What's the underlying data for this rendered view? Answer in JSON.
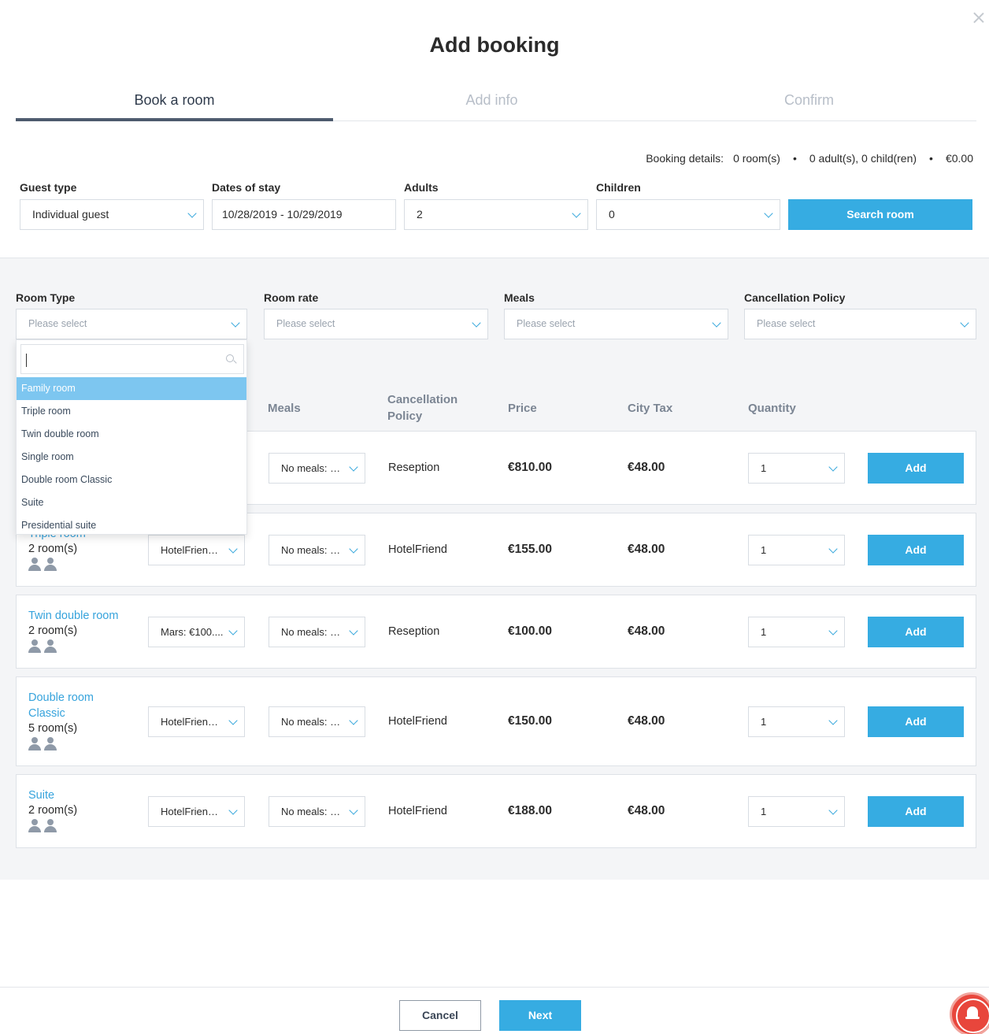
{
  "modal": {
    "title": "Add booking"
  },
  "tabs": [
    {
      "label": "Book a room"
    },
    {
      "label": "Add info"
    },
    {
      "label": "Confirm"
    }
  ],
  "booking_details": {
    "label": "Booking details:",
    "rooms": "0 room(s)",
    "guests": "0 adult(s), 0 child(ren)",
    "total": "€0.00",
    "separator": "•"
  },
  "search_form": {
    "guest_type": {
      "label": "Guest type",
      "value": "Individual guest"
    },
    "dates": {
      "label": "Dates of stay",
      "value": "10/28/2019 - 10/29/2019"
    },
    "adults": {
      "label": "Adults",
      "value": "2"
    },
    "children": {
      "label": "Children",
      "value": "0"
    },
    "search_button": "Search room"
  },
  "filters": {
    "room_type": {
      "label": "Room Type",
      "placeholder": "Please select"
    },
    "room_rate": {
      "label": "Room rate",
      "placeholder": "Please select"
    },
    "meals": {
      "label": "Meals",
      "placeholder": "Please select"
    },
    "cancellation": {
      "label": "Cancellation Policy",
      "placeholder": "Please select"
    }
  },
  "room_type_dropdown": {
    "search_value": "",
    "options": [
      {
        "label": "Family room",
        "selected": true
      },
      {
        "label": "Triple room",
        "selected": false
      },
      {
        "label": "Twin double room",
        "selected": false
      },
      {
        "label": "Single room",
        "selected": false
      },
      {
        "label": "Double room Classic",
        "selected": false
      },
      {
        "label": "Suite",
        "selected": false
      },
      {
        "label": "Presidential suite",
        "selected": false
      }
    ]
  },
  "table": {
    "headers": {
      "meals": "Meals",
      "cancellation": "Cancellation Policy",
      "price": "Price",
      "city_tax": "City Tax",
      "quantity": "Quantity"
    },
    "rows": [
      {
        "name": "",
        "rooms": "",
        "rate": "",
        "meals": "No meals: €...",
        "policy": "Reseption",
        "price": "€810.00",
        "city_tax": "€48.00",
        "quantity": "1",
        "add": "Add"
      },
      {
        "name": "Triple room",
        "rooms": "2 room(s)",
        "rate": "HotelFriend:...",
        "meals": "No meals: €...",
        "policy": "HotelFriend",
        "price": "€155.00",
        "city_tax": "€48.00",
        "quantity": "1",
        "add": "Add"
      },
      {
        "name": "Twin double room",
        "rooms": "2 room(s)",
        "rate": "Mars: €100....",
        "meals": "No meals: €...",
        "policy": "Reseption",
        "price": "€100.00",
        "city_tax": "€48.00",
        "quantity": "1",
        "add": "Add"
      },
      {
        "name": "Double room Classic",
        "rooms": "5 room(s)",
        "rate": "HotelFriend:...",
        "meals": "No meals: €...",
        "policy": "HotelFriend",
        "price": "€150.00",
        "city_tax": "€48.00",
        "quantity": "1",
        "add": "Add"
      },
      {
        "name": "Suite",
        "rooms": "2 room(s)",
        "rate": "HotelFriend:...",
        "meals": "No meals: €...",
        "policy": "HotelFriend",
        "price": "€188.00",
        "city_tax": "€48.00",
        "quantity": "1",
        "add": "Add"
      }
    ]
  },
  "footer": {
    "cancel": "Cancel",
    "next": "Next"
  },
  "colors": {
    "accent": "#36ace2",
    "link": "#36a3dc",
    "selected_option": "#7dc6f0",
    "notification": "#e8463c"
  }
}
